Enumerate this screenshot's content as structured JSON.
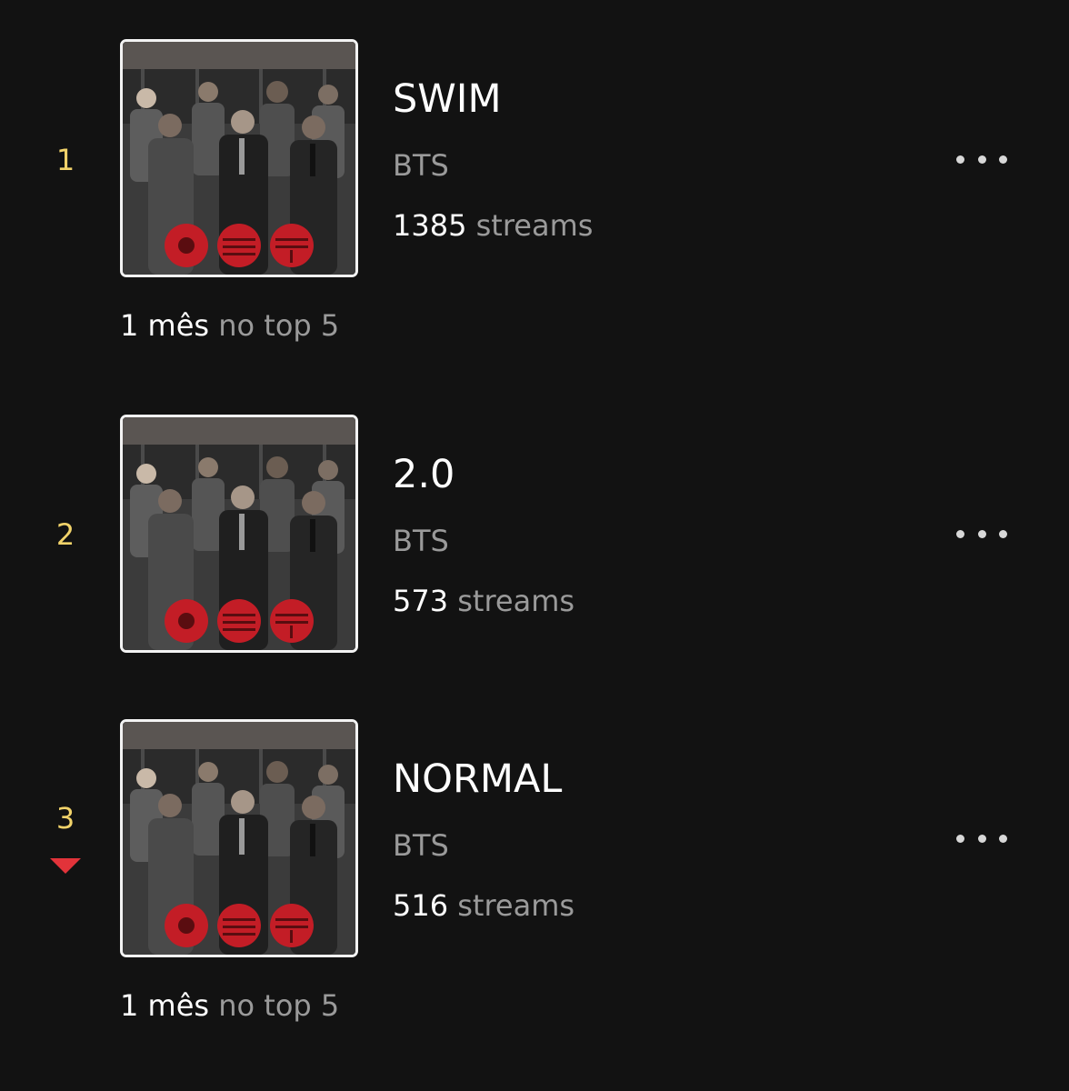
{
  "tracks": [
    {
      "rank": "1",
      "title": "SWIM",
      "artist": "BTS",
      "streams_count": "1385",
      "streams_unit": "streams",
      "note_strong": "1 mês",
      "note_muted": "no top 5",
      "trend": "none"
    },
    {
      "rank": "2",
      "title": "2.0",
      "artist": "BTS",
      "streams_count": "573",
      "streams_unit": "streams",
      "trend": "none"
    },
    {
      "rank": "3",
      "title": "NORMAL",
      "artist": "BTS",
      "streams_count": "516",
      "streams_unit": "streams",
      "note_strong": "1 mês",
      "note_muted": "no top 5",
      "trend": "down"
    }
  ],
  "colors": {
    "background": "#121212",
    "rank": "#f2d36a",
    "trend_down": "#e2333a",
    "muted_text": "#9a9a9a"
  },
  "icons": {
    "more": "more-horizontal-icon",
    "trend_down": "triangle-down-icon"
  }
}
